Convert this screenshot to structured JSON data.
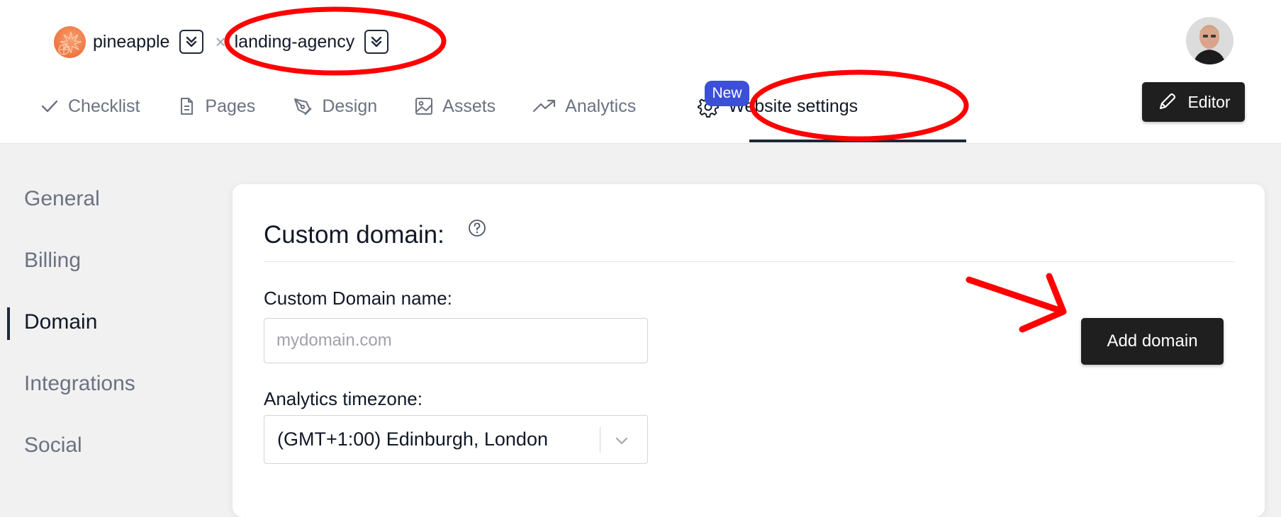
{
  "header": {
    "project_name": "pineapple",
    "separator": "×",
    "site_name": "landing-agency",
    "editor_label": "Editor"
  },
  "nav": {
    "items": [
      {
        "label": "Checklist",
        "icon": "check-icon"
      },
      {
        "label": "Pages",
        "icon": "document-icon"
      },
      {
        "label": "Design",
        "icon": "pen-tool-icon"
      },
      {
        "label": "Assets",
        "icon": "image-icon"
      },
      {
        "label": "Analytics",
        "icon": "trend-up-icon"
      },
      {
        "label": "Website settings",
        "icon": "gear-icon",
        "active": true
      }
    ],
    "badge": "New"
  },
  "sidebar": {
    "items": [
      {
        "label": "General"
      },
      {
        "label": "Billing"
      },
      {
        "label": "Domain",
        "active": true
      },
      {
        "label": "Integrations"
      },
      {
        "label": "Social"
      }
    ]
  },
  "main": {
    "title": "Custom domain:",
    "domain_label": "Custom Domain name:",
    "domain_placeholder": "mydomain.com",
    "domain_value": "",
    "add_button": "Add domain",
    "timezone_label": "Analytics timezone:",
    "timezone_value": "(GMT+1:00) Edinburgh, London"
  },
  "colors": {
    "accent_dark": "#1f1f1f",
    "badge_blue": "#3b4fd8",
    "annotation_red": "#ff0000",
    "logo_orange": "#ee7440"
  }
}
